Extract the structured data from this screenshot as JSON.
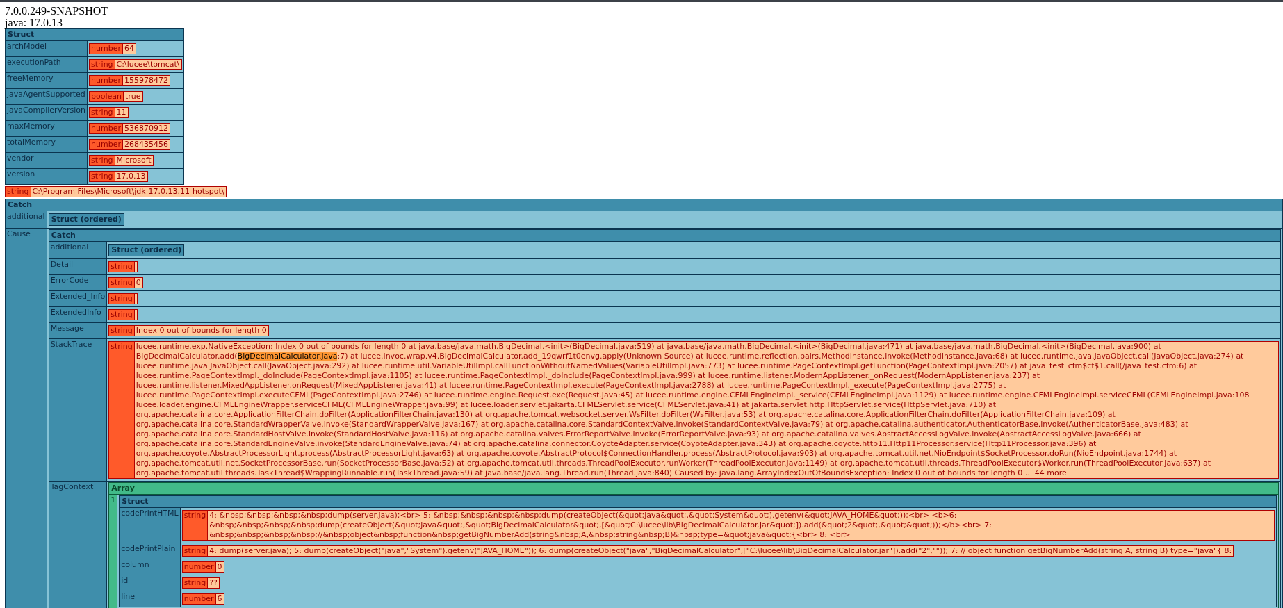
{
  "header": {
    "version": "7.0.0.249-SNAPSHOT",
    "java": "java: 17.0.13"
  },
  "dumps": [
    {
      "kind": "struct",
      "title": "Struct",
      "collapsed": false,
      "rows": [
        {
          "key": "archModel",
          "value": {
            "kind": "simple",
            "label": "number",
            "value": "64"
          }
        },
        {
          "key": "executionPath",
          "value": {
            "kind": "simple",
            "label": "string",
            "value": "C:\\lucee\\tomcat\\"
          }
        },
        {
          "key": "freeMemory",
          "value": {
            "kind": "simple",
            "label": "number",
            "value": "155978472"
          }
        },
        {
          "key": "javaAgentSupported",
          "value": {
            "kind": "simple",
            "label": "boolean",
            "value": "true"
          }
        },
        {
          "key": "javaCompilerVersion",
          "value": {
            "kind": "simple",
            "label": "string",
            "value": "11"
          }
        },
        {
          "key": "maxMemory",
          "value": {
            "kind": "simple",
            "label": "number",
            "value": "536870912"
          }
        },
        {
          "key": "totalMemory",
          "value": {
            "kind": "simple",
            "label": "number",
            "value": "268435456"
          }
        },
        {
          "key": "vendor",
          "value": {
            "kind": "simple",
            "label": "string",
            "value": "Microsoft"
          }
        },
        {
          "key": "version",
          "value": {
            "kind": "simple",
            "label": "string",
            "value": "17.0.13"
          }
        }
      ]
    },
    {
      "kind": "simple",
      "label": "string",
      "value": "C:\\Program Files\\Microsoft\\jdk-17.0.13.11-hotspot\\"
    },
    {
      "kind": "struct",
      "title": "Catch",
      "collapsed": false,
      "rows": [
        {
          "key": "additional",
          "value": {
            "kind": "struct",
            "title": "Struct (ordered)",
            "collapsed": true
          }
        },
        {
          "key": "Cause",
          "value": {
            "kind": "struct",
            "title": "Catch",
            "collapsed": false,
            "rows": [
              {
                "key": "additional",
                "value": {
                  "kind": "struct",
                  "title": "Struct (ordered)",
                  "collapsed": true
                }
              },
              {
                "key": "Detail",
                "value": {
                  "kind": "simple",
                  "label": "string"
                }
              },
              {
                "key": "ErrorCode",
                "value": {
                  "kind": "simple",
                  "label": "string",
                  "value": "0"
                }
              },
              {
                "key": "Extended_Info",
                "value": {
                  "kind": "simple",
                  "label": "string"
                }
              },
              {
                "key": "ExtendedInfo",
                "value": {
                  "kind": "simple",
                  "label": "string"
                }
              },
              {
                "key": "Message",
                "value": {
                  "kind": "simple",
                  "label": "string",
                  "value": "Index 0 out of bounds for length 0"
                }
              },
              {
                "key": "StackTrace",
                "value": {
                  "kind": "simple",
                  "label": "string",
                  "parts": [
                    {
                      "text": "lucee.runtime.exp.NativeException: Index 0 out of bounds for length 0 at java.base/java.math.BigDecimal.<init>(BigDecimal.java:519) at java.base/java.math.BigDecimal.<init>(BigDecimal.java:471) at java.base/java.math.BigDecimal.<init>(BigDecimal.java:900) at BigDecimalCalculator.add(",
                      "highlighted": false
                    },
                    {
                      "text": "BigDecimalCalculator.java",
                      "highlighted": true
                    },
                    {
                      "text": ":7) at lucee.invoc.wrap.v4.BigDecimalCalculator.add_19qwrf1t0envg.apply(Unknown Source) at lucee.runtime.reflection.pairs.MethodInstance.invoke(MethodInstance.java:68) at lucee.runtime.java.JavaObject.call(JavaObject.java:274) at lucee.runtime.java.JavaObject.call(JavaObject.java:292) at lucee.runtime.util.VariableUtilImpl.callFunctionWithoutNamedValues(VariableUtilImpl.java:773) at lucee.runtime.PageContextImpl.getFunction(PageContextImpl.java:2057) at java_test_cfm$cf$1.call(/java_test.cfm:6) at lucee.runtime.PageContextImpl._doInclude(PageContextImpl.java:1105) at lucee.runtime.PageContextImpl._doInclude(PageContextImpl.java:999) at lucee.runtime.listener.ModernAppListener._onRequest(ModernAppListener.java:237) at lucee.runtime.listener.MixedAppListener.onRequest(MixedAppListener.java:41) at lucee.runtime.PageContextImpl.execute(PageContextImpl.java:2788) at lucee.runtime.PageContextImpl._execute(PageContextImpl.java:2775) at lucee.runtime.PageContextImpl.executeCFML(PageContextImpl.java:2746) at lucee.runtime.engine.Request.exe(Request.java:45) at lucee.runtime.engine.CFMLEngineImpl._service(CFMLEngineImpl.java:1129) at lucee.runtime.engine.CFMLEngineImpl.serviceCFML(CFMLEngineImpl.java:108 lucee.loader.engine.CFMLEngineWrapper.serviceCFML(CFMLEngineWrapper.java:99) at lucee.loader.servlet.jakarta.CFMLServlet.service(CFMLServlet.java:41) at jakarta.servlet.http.HttpServlet.service(HttpServlet.java:710) at org.apache.catalina.core.ApplicationFilterChain.doFilter(ApplicationFilterChain.java:130) at org.apache.tomcat.websocket.server.WsFilter.doFilter(WsFilter.java:53) at org.apache.catalina.core.ApplicationFilterChain.doFilter(ApplicationFilterChain.java:109) at org.apache.catalina.core.StandardWrapperValve.invoke(StandardWrapperValve.java:167) at org.apache.catalina.core.StandardContextValve.invoke(StandardContextValve.java:79) at org.apache.catalina.authenticator.AuthenticatorBase.invoke(AuthenticatorBase.java:483) at org.apache.catalina.core.StandardHostValve.invoke(StandardHostValve.java:116) at org.apache.catalina.valves.ErrorReportValve.invoke(ErrorReportValve.java:93) at org.apache.catalina.valves.AbstractAccessLogValve.invoke(AbstractAccessLogValve.java:666) at org.apache.catalina.core.StandardEngineValve.invoke(StandardEngineValve.java:74) at org.apache.catalina.connector.CoyoteAdapter.service(CoyoteAdapter.java:343) at org.apache.coyote.http11.Http11Processor.service(Http11Processor.java:396) at org.apache.coyote.AbstractProcessorLight.process(AbstractProcessorLight.java:63) at org.apache.coyote.AbstractProtocol$ConnectionHandler.process(AbstractProtocol.java:903) at org.apache.tomcat.util.net.NioEndpoint$SocketProcessor.doRun(NioEndpoint.java:1744) at org.apache.tomcat.util.net.SocketProcessorBase.run(SocketProcessorBase.java:52) at org.apache.tomcat.util.threads.ThreadPoolExecutor.runWorker(ThreadPoolExecutor.java:1149) at org.apache.tomcat.util.threads.ThreadPoolExecutor$Worker.run(ThreadPoolExecutor.java:637) at org.apache.tomcat.util.threads.TaskThread$WrappingRunnable.run(TaskThread.java:59) at java.base/java.lang.Thread.run(Thread.java:840) Caused by: java.lang.ArrayIndexOutOfBoundsException: Index 0 out of bounds for length 0 ... 44 more",
                      "highlighted": false
                    }
                  ]
                }
              },
              {
                "key": "TagContext",
                "value": {
                  "kind": "array",
                  "title": "Array",
                  "items": [
                    {
                      "index": "1",
                      "value": {
                        "kind": "struct",
                        "title": "Struct",
                        "collapsed": false,
                        "rows": [
                          {
                            "key": "codePrintHTML",
                            "value": {
                              "kind": "simple",
                              "label": "string",
                              "value": "4: &nbsp;&nbsp;&nbsp;&nbsp;dump(server.java);<br> 5: &nbsp;&nbsp;&nbsp;&nbsp;dump(createObject(&quot;java&quot;,&quot;System&quot;).getenv(&quot;JAVA_HOME&quot;));<br> <b>6: &nbsp;&nbsp;&nbsp;&nbsp;dump(createObject(&quot;java&quot;,&quot;BigDecimalCalculator&quot;,[&quot;C:\\lucee\\lib\\BigDecimalCalculator.jar&quot;]).add(&quot;2&quot;,&quot;&quot;));</b><br> 7: &nbsp;&nbsp;&nbsp;&nbsp;//&nbsp;object&nbsp;function&nbsp;getBigNumberAdd(string&nbsp;A,&nbsp;string&nbsp;B)&nbsp;type=&quot;java&quot;{<br> 8: <br>"
                            }
                          },
                          {
                            "key": "codePrintPlain",
                            "value": {
                              "kind": "simple",
                              "label": "string",
                              "value": "4: dump(server.java); 5: dump(createObject(\"java\",\"System\").getenv(\"JAVA_HOME\")); 6: dump(createObject(\"java\",\"BigDecimalCalculator\",[\"C:\\lucee\\lib\\BigDecimalCalculator.jar\"]).add(\"2\",\"\")); 7: // object function getBigNumberAdd(string A, string B) type=\"java\"{ 8:"
                            }
                          },
                          {
                            "key": "column",
                            "value": {
                              "kind": "simple",
                              "label": "number",
                              "value": "0"
                            }
                          },
                          {
                            "key": "id",
                            "value": {
                              "kind": "simple",
                              "label": "string",
                              "value": "??"
                            }
                          },
                          {
                            "key": "line",
                            "value": {
                              "kind": "simple",
                              "label": "number",
                              "value": "6"
                            }
                          }
                        ]
                      }
                    }
                  ]
                }
              }
            ]
          }
        }
      ]
    }
  ]
}
